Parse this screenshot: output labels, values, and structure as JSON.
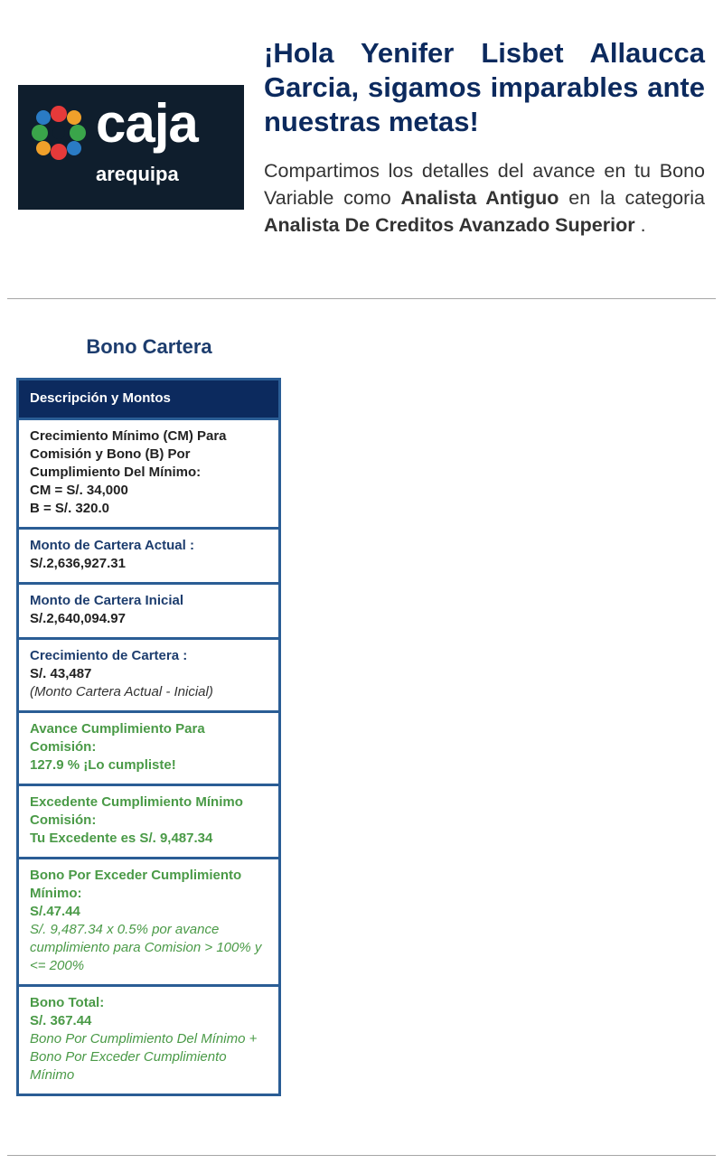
{
  "brand": {
    "name": "caja",
    "sub": "arequipa",
    "colors": {
      "bg": "#0f1e2d",
      "red": "#e63a3a",
      "green": "#3aa54a",
      "blue": "#2a7bc4",
      "orange": "#f0a02a"
    }
  },
  "header": {
    "greeting": "¡Hola Yenifer Lisbet Allaucca Garcia, sigamos imparables ante nuestras metas!",
    "intro_part1": "Compartimos los detalles del avance en tu Bono Variable como ",
    "role": "Analista Antiguo",
    "intro_part2": " en la categoria ",
    "category": "Analista De Creditos Avanzado Superior",
    "intro_end": " ."
  },
  "bono": {
    "title": "Bono Cartera",
    "table_header": "Descripción y Montos",
    "cm": {
      "label_line1": "Crecimiento Mínimo (CM) Para",
      "label_line2": "Comisión y Bono (B) Por",
      "label_line3": "Cumplimiento Del Mínimo:",
      "cm_value": "CM = S/. 34,000",
      "b_value": "B = S/. 320.0"
    },
    "actual": {
      "label": "Monto de Cartera Actual :",
      "value": "S/.2,636,927.31"
    },
    "inicial": {
      "label": "Monto de Cartera Inicial",
      "value": "S/.2,640,094.97"
    },
    "crecimiento": {
      "label": "Crecimiento de Cartera :",
      "value": "S/. 43,487",
      "note": "(Monto Cartera Actual - Inicial)"
    },
    "avance": {
      "label": "Avance Cumplimiento Para Comisión:",
      "value": "127.9 % ¡Lo cumpliste!"
    },
    "excedente": {
      "label": "Excedente Cumplimiento Mínimo Comisión:",
      "value": "Tu Excedente es S/. 9,487.34"
    },
    "bono_exceder": {
      "label": "Bono Por Exceder Cumplimiento Mínimo:",
      "value": "S/.47.44",
      "note": "S/. 9,487.34 x 0.5% por avance cumplimiento para Comision > 100% y <= 200%"
    },
    "bono_total": {
      "label": "Bono Total:",
      "value": "S/. 367.44",
      "note": "Bono Por Cumplimiento Del Mínimo + Bono Por Exceder Cumplimiento Mínimo"
    }
  }
}
